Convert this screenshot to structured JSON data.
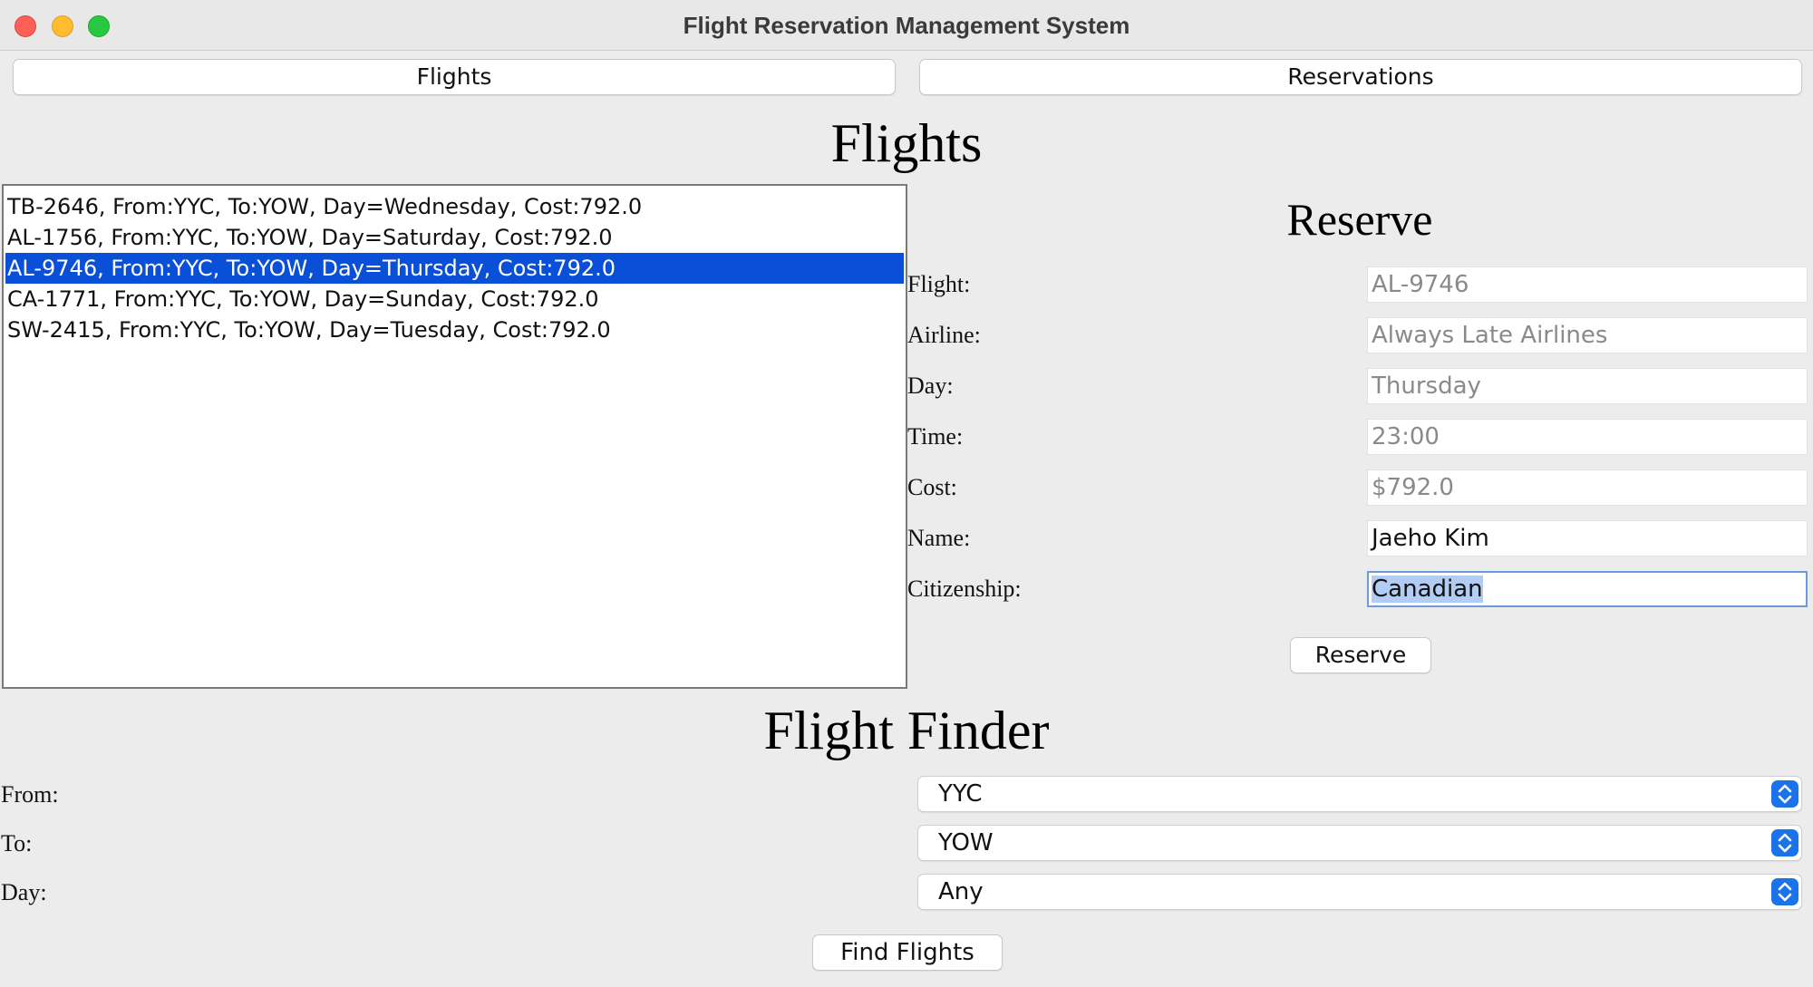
{
  "window": {
    "title": "Flight Reservation Management System"
  },
  "tabs": [
    {
      "label": "Flights"
    },
    {
      "label": "Reservations"
    }
  ],
  "flights_section": {
    "heading": "Flights",
    "list": [
      {
        "text": "TB-2646, From:YYC, To:YOW, Day=Wednesday, Cost:792.0",
        "selected": false
      },
      {
        "text": "AL-1756, From:YYC, To:YOW, Day=Saturday, Cost:792.0",
        "selected": false
      },
      {
        "text": "AL-9746, From:YYC, To:YOW, Day=Thursday, Cost:792.0",
        "selected": true
      },
      {
        "text": "CA-1771, From:YYC, To:YOW, Day=Sunday, Cost:792.0",
        "selected": false
      },
      {
        "text": "SW-2415, From:YYC, To:YOW, Day=Tuesday, Cost:792.0",
        "selected": false
      }
    ]
  },
  "reserve": {
    "heading": "Reserve",
    "fields": [
      {
        "label": "Flight:",
        "value": "AL-9746",
        "editable": false
      },
      {
        "label": "Airline:",
        "value": "Always Late Airlines",
        "editable": false
      },
      {
        "label": "Day:",
        "value": "Thursday",
        "editable": false
      },
      {
        "label": "Time:",
        "value": "23:00",
        "editable": false
      },
      {
        "label": "Cost:",
        "value": "$792.0",
        "editable": false
      },
      {
        "label": "Name:",
        "value": "Jaeho Kim",
        "editable": true
      },
      {
        "label": "Citizenship:",
        "value": "Canadian",
        "editable": true
      }
    ],
    "button_label": "Reserve"
  },
  "finder": {
    "heading": "Flight Finder",
    "from_label": "From:",
    "from_value": "YYC",
    "to_label": "To:",
    "to_value": "YOW",
    "day_label": "Day:",
    "day_value": "Any",
    "button_label": "Find Flights"
  },
  "colors": {
    "selection": "#0a4fd8",
    "text_selection": "#b2cdf3",
    "combo_arrow": "#1a73e8",
    "close": "#fe5f57",
    "minimize": "#febc2e",
    "maximize": "#28c840"
  }
}
